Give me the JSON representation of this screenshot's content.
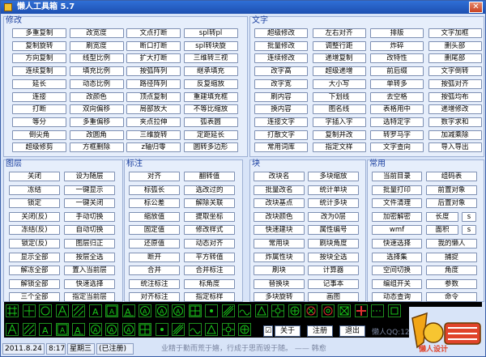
{
  "title": "懒人工具箱 5.7",
  "groups": {
    "modify": {
      "title": "修改",
      "rows": [
        [
          "多重复制",
          "改宽度",
          "文点打断",
          "spl转pl"
        ],
        [
          "复制旋转",
          "刷宽度",
          "断口打断",
          "spl转块旋"
        ],
        [
          "方向复制",
          "线型比例",
          "扩大打断",
          "三维转三视"
        ],
        [
          "连续复制",
          "填充比例",
          "按弧阵列",
          "继承填充"
        ],
        [
          "延长",
          "动态比例",
          "路径阵列",
          "反复缩放"
        ],
        [
          "连接",
          "改颜色",
          "顶点复制",
          "重建填充框"
        ],
        [
          "打断",
          "双向偏移",
          "局部放大",
          "不等比缩放"
        ],
        [
          "等分",
          "多重偏移",
          "夹点拉伸",
          "弧表圆"
        ],
        [
          "倒尖角",
          "改圆角",
          "三维旋转",
          "定距延长"
        ],
        [
          "超级修剪",
          "方框删除",
          "z轴归零",
          "圆转多边形"
        ]
      ]
    },
    "text": {
      "title": "文字",
      "rows": [
        [
          "超级修改",
          "左右对齐",
          "排版",
          "文字加框"
        ],
        [
          "批量修改",
          "调整行距",
          "炸碎",
          "删头部"
        ],
        [
          "连续修改",
          "递增复制",
          "改特性",
          "删尾部"
        ],
        [
          "改字高",
          "超级递增",
          "前后缀",
          "文字倒转"
        ],
        [
          "改字宽",
          "大小写",
          "单转多",
          "按弧对齐"
        ],
        [
          "刷内容",
          "下划线",
          "去空格",
          "按弧均布"
        ],
        [
          "换内容",
          "图名线",
          "表格用中",
          "递增修改"
        ],
        [
          "连接文字",
          "字插入字",
          "选特定字",
          "数字求和"
        ],
        [
          "打散文字",
          "复制并改",
          "转罗马字",
          "加减乘除"
        ],
        [
          "常用词库",
          "指定文样",
          "文字查向",
          "导入导出"
        ]
      ]
    },
    "layer": {
      "title": "图层",
      "rows": [
        [
          "关闭",
          "设为随层"
        ],
        [
          "冻结",
          "一键显示"
        ],
        [
          "锁定",
          "一键关闭"
        ],
        [
          "关闭(反)",
          "手动切换"
        ],
        [
          "冻结(反)",
          "自动切换"
        ],
        [
          "锁定(反)",
          "图层归正"
        ],
        [
          "显示全部",
          "按层全选"
        ],
        [
          "解冻全部",
          "置入当前层"
        ],
        [
          "解锁全部",
          "快速选择"
        ],
        [
          "三个全部",
          "指定当前层"
        ]
      ]
    },
    "dim": {
      "title": "标注",
      "rows": [
        [
          "对齐",
          "翻转值"
        ],
        [
          "标弧长",
          "选改过的"
        ],
        [
          "标公差",
          "解除关联"
        ],
        [
          "缩放值",
          "提取坐标"
        ],
        [
          "固定值",
          "修改样式"
        ],
        [
          "还原值",
          "动态对齐"
        ],
        [
          "断开",
          "平方转值"
        ],
        [
          "合并",
          "合并标注"
        ],
        [
          "统注标注",
          "标角度"
        ],
        [
          "对齐标注",
          "指定标样"
        ]
      ]
    },
    "block": {
      "title": "块",
      "rows": [
        [
          "改块名",
          "多块缩放"
        ],
        [
          "批量改名",
          "统计单块"
        ],
        [
          "改块基点",
          "统计多块"
        ],
        [
          "改块颜色",
          "改为0层"
        ],
        [
          "快速建块",
          "属性编号"
        ],
        [
          "常用块",
          "刷块角度"
        ],
        [
          "炸属性块",
          "按块全选"
        ],
        [
          "刷块",
          "计算器"
        ],
        [
          "替换块",
          "记事本"
        ],
        [
          "多块旋转",
          "画图"
        ]
      ]
    },
    "common": {
      "title": "常用",
      "rows": [
        [
          "当前目录",
          "组码表"
        ],
        [
          "批量打印",
          "前置对象"
        ],
        [
          "文件清理",
          "后置对象"
        ],
        [
          "加密解密",
          "长度",
          "s"
        ],
        [
          "wmf",
          "面积",
          "s"
        ],
        [
          "快速选择",
          "我的懒人"
        ],
        [
          "选择集",
          "捕捉"
        ],
        [
          "空间切换",
          "角度"
        ],
        [
          "编组开关",
          "参数"
        ],
        [
          "动态查询",
          "命令"
        ]
      ]
    }
  },
  "window_buttons": {
    "about": "关于",
    "register": "注册",
    "exit": "退出"
  },
  "status": {
    "date": "2011.8.24",
    "time": "8:17",
    "weekday": "星期三",
    "reg": "(已注册)",
    "marquee": "业精于勤而荒于嬉，行成于思而毁于随。  ——  韩愈",
    "user_label": "懒人QQ:12",
    "logo_text": "懒人设计"
  },
  "icons": [
    "grid-icon",
    "cross-icon",
    "ring-icon",
    "tree-icon",
    "hatch-icon",
    "letter-a-icon",
    "box-a-icon",
    "letter-a2-icon",
    "rotate-a-icon",
    "circle-a-icon",
    "circle-a2-icon",
    "grid-dot-icon",
    "dot-icon",
    "diag-lines-icon",
    "wave-icon",
    "shape-icon",
    "sun-icon",
    "circle-plus-icon",
    "circle-x-icon",
    "target-icon",
    "rect-x-icon",
    "cross-red-icon",
    "dashed-icon",
    "square-icon"
  ],
  "colors": {
    "accent": "#1a3fa0",
    "titlebar": "#2f6fd6",
    "iconbar": "#000000",
    "icon_green": "#19c919"
  }
}
